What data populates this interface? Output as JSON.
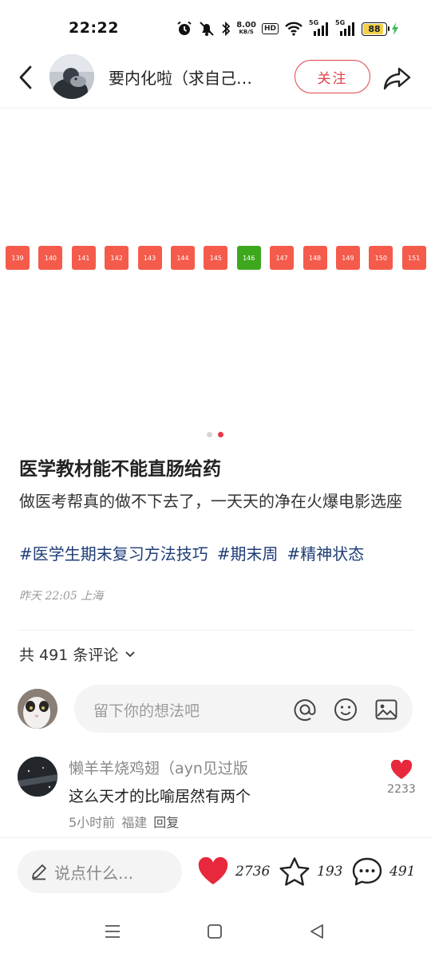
{
  "status_bar": {
    "time": "22:22",
    "net_speed_value": "8.00",
    "net_speed_unit": "KB/S",
    "hd_badge": "HD",
    "sim1_label": "5G",
    "sim2_label": "5G",
    "battery_level": "88",
    "battery_color": "#f2d04a"
  },
  "header": {
    "author_name": "要内化啦（求自己…",
    "follow_label": "关注"
  },
  "media": {
    "seats": [
      "139",
      "140",
      "141",
      "142",
      "143",
      "144",
      "145",
      "146",
      "147",
      "148",
      "149",
      "150",
      "151"
    ],
    "selected_seat": "146",
    "seat_color": "#f55b4b",
    "selected_seat_color": "#3ea81d",
    "page_count": 2,
    "current_page": 2
  },
  "post": {
    "title": "医学教材能不能直肠给药",
    "body": "做医考帮真的做不下去了，一天天的净在火爆电影选座",
    "tags": [
      "#医学生期末复习方法技巧",
      "#期末周",
      "#精神状态"
    ],
    "meta": "昨天 22:05 上海"
  },
  "comments": {
    "count_label": "共 491 条评论",
    "input_placeholder": "留下你的想法吧",
    "items": [
      {
        "user": "懒羊羊烧鸡翅（ayn见过版",
        "text": "这么天才的比喻居然有两个",
        "time": "5小时前",
        "location": "福建",
        "reply_label": "回复",
        "likes": "2233"
      }
    ]
  },
  "action_bar": {
    "say_placeholder": "说点什么...",
    "like_count": "2736",
    "collect_count": "193",
    "comment_count": "491",
    "like_color": "#e8283c"
  }
}
